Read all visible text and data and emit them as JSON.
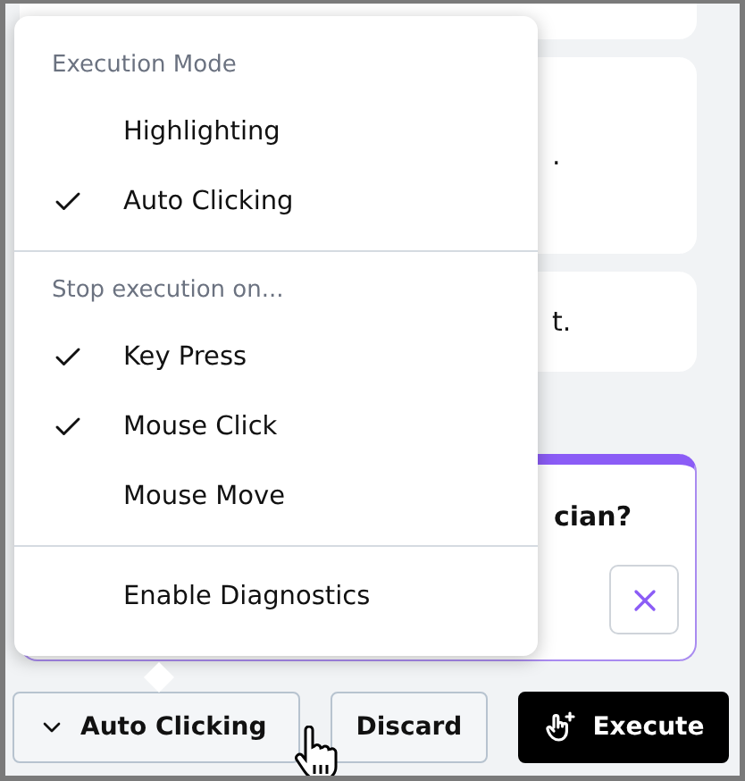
{
  "cards": [
    {
      "kind": "blank"
    },
    {
      "kind": "note",
      "text": "."
    },
    {
      "kind": "note",
      "text": "t."
    },
    {
      "kind": "question",
      "text": "cian?"
    }
  ],
  "menu": {
    "sections": [
      {
        "header": "Execution Mode",
        "items": [
          {
            "label": "Highlighting",
            "checked": false
          },
          {
            "label": "Auto Clicking",
            "checked": true
          }
        ]
      },
      {
        "header": "Stop execution on...",
        "items": [
          {
            "label": "Key Press",
            "checked": true
          },
          {
            "label": "Mouse Click",
            "checked": true
          },
          {
            "label": "Mouse Move",
            "checked": false
          }
        ]
      },
      {
        "items": [
          {
            "label": "Enable Diagnostics",
            "checked": false
          }
        ]
      }
    ]
  },
  "footer": {
    "mode_button": "Auto Clicking",
    "discard": "Discard",
    "execute": "Execute"
  }
}
